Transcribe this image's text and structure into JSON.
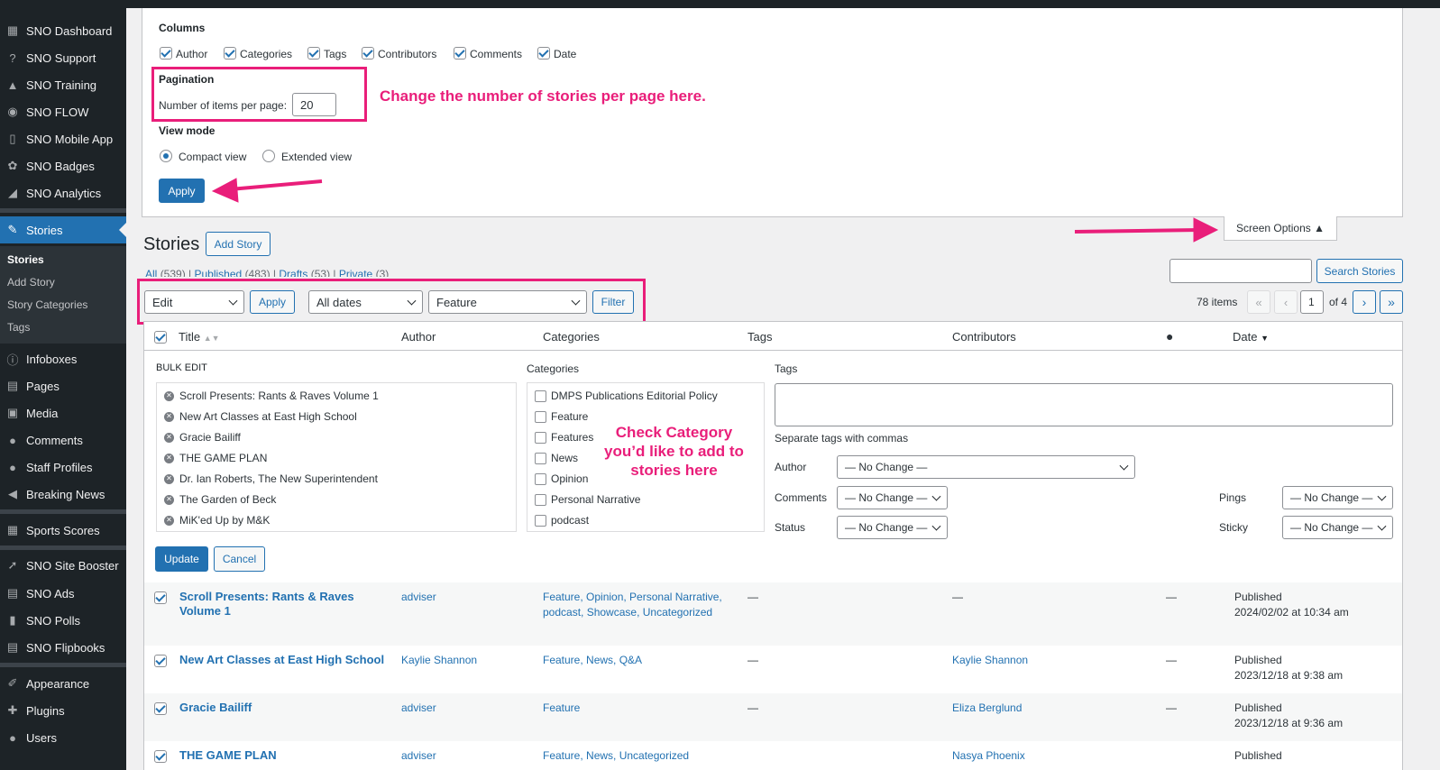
{
  "sidebar": {
    "items": [
      {
        "label": "SNO Dashboard",
        "icon": "dashboard-icon"
      },
      {
        "label": "SNO Support",
        "icon": "support-icon"
      },
      {
        "label": "SNO Training",
        "icon": "training-icon"
      },
      {
        "label": "SNO FLOW",
        "icon": "flow-icon"
      },
      {
        "label": "SNO Mobile App",
        "icon": "mobile-icon"
      },
      {
        "label": "SNO Badges",
        "icon": "badge-icon"
      },
      {
        "label": "SNO Analytics",
        "icon": "analytics-icon"
      },
      {
        "label": "Stories",
        "icon": "pin-icon",
        "current": true
      },
      {
        "label": "Infoboxes",
        "icon": "info-icon"
      },
      {
        "label": "Pages",
        "icon": "pages-icon"
      },
      {
        "label": "Media",
        "icon": "media-icon"
      },
      {
        "label": "Comments",
        "icon": "comments-icon"
      },
      {
        "label": "Staff Profiles",
        "icon": "user-icon"
      },
      {
        "label": "Breaking News",
        "icon": "megaphone-icon"
      },
      {
        "label": "Sports Scores",
        "icon": "calendar-icon"
      },
      {
        "label": "SNO Site Booster",
        "icon": "rocket-icon"
      },
      {
        "label": "SNO Ads",
        "icon": "ads-icon"
      },
      {
        "label": "SNO Polls",
        "icon": "polls-icon"
      },
      {
        "label": "SNO Flipbooks",
        "icon": "flipbook-icon"
      },
      {
        "label": "Appearance",
        "icon": "brush-icon"
      },
      {
        "label": "Plugins",
        "icon": "plugin-icon"
      },
      {
        "label": "Users",
        "icon": "users-icon"
      }
    ],
    "submenu": [
      "Stories",
      "Add Story",
      "Story Categories",
      "Tags"
    ]
  },
  "screen_options": {
    "columns_heading": "Columns",
    "columns": [
      {
        "label": "Author",
        "checked": true
      },
      {
        "label": "Categories",
        "checked": true
      },
      {
        "label": "Tags",
        "checked": true
      },
      {
        "label": "Contributors",
        "checked": true
      },
      {
        "label": "Comments",
        "checked": true
      },
      {
        "label": "Date",
        "checked": true
      }
    ],
    "pagination_heading": "Pagination",
    "per_page_label": "Number of items per page:",
    "per_page_value": "20",
    "view_mode_heading": "View mode",
    "compact_label": "Compact view",
    "extended_label": "Extended view",
    "apply_label": "Apply",
    "toggle_label": "Screen Options ▲"
  },
  "annotations": {
    "per_page": "Change the number of stories per page here.",
    "category": "Check Category you’d like to add to stories here"
  },
  "page": {
    "title": "Stories",
    "add_label": "Add Story",
    "filters": [
      {
        "label": "All",
        "count": "(539)"
      },
      {
        "label": "Published",
        "count": "(483)"
      },
      {
        "label": "Drafts",
        "count": "(53)"
      },
      {
        "label": "Private",
        "count": "(3)"
      }
    ],
    "search_button": "Search Stories",
    "bulk_action": "Edit",
    "bulk_apply": "Apply",
    "dates": "All dates",
    "category_filter": "Feature",
    "filter_button": "Filter",
    "items_count": "78 items",
    "page_current": "1",
    "page_total": "of 4",
    "first": "«",
    "prev": "‹",
    "next": "›",
    "last": "»"
  },
  "table": {
    "headers": {
      "title": "Title",
      "author": "Author",
      "categories": "Categories",
      "tags": "Tags",
      "contributors": "Contributors",
      "date": "Date"
    },
    "bulk": {
      "heading": "BULK EDIT",
      "titles": [
        "Scroll Presents: Rants & Raves Volume 1",
        "New Art Classes at East High School",
        "Gracie Bailiff",
        "THE GAME PLAN",
        "Dr. Ian Roberts, The New Superintendent",
        "The Garden of Beck",
        "MiK'ed Up by M&K"
      ],
      "categories_heading": "Categories",
      "categories": [
        "DMPS Publications Editorial Policy",
        "Feature",
        "Features",
        "News",
        "Opinion",
        "Personal Narrative",
        "podcast"
      ],
      "tags_heading": "Tags",
      "tags_hint": "Separate tags with commas",
      "author_label": "Author",
      "comments_label": "Comments",
      "status_label": "Status",
      "pings_label": "Pings",
      "sticky_label": "Sticky",
      "no_change": "— No Change —",
      "update_label": "Update",
      "cancel_label": "Cancel"
    },
    "rows": [
      {
        "title": "Scroll Presents: Rants & Raves Volume 1",
        "author": "adviser",
        "categories": "Feature, Opinion, Personal Narrative, podcast, Showcase, Uncategorized",
        "tags": "—",
        "contributors": "—",
        "comments": "—",
        "status": "Published",
        "date": "2024/02/02 at 10:34 am"
      },
      {
        "title": "New Art Classes at East High School",
        "author": "Kaylie Shannon",
        "categories": "Feature, News, Q&A",
        "tags": "—",
        "contributors": "Kaylie Shannon",
        "comments": "—",
        "status": "Published",
        "date": "2023/12/18 at 9:38 am"
      },
      {
        "title": "Gracie Bailiff",
        "author": "adviser",
        "categories": "Feature",
        "tags": "—",
        "contributors": "Eliza Berglund",
        "comments": "—",
        "status": "Published",
        "date": "2023/12/18 at 9:36 am"
      },
      {
        "title": "THE GAME PLAN",
        "author": "adviser",
        "categories": "Feature, News, Uncategorized",
        "tags": "",
        "contributors": "Nasya Phoenix",
        "comments": "",
        "status": "Published",
        "date": ""
      }
    ]
  },
  "colors": {
    "accent": "#2271b1",
    "sidebar": "#1d2327",
    "highlight": "#e91e7a"
  }
}
